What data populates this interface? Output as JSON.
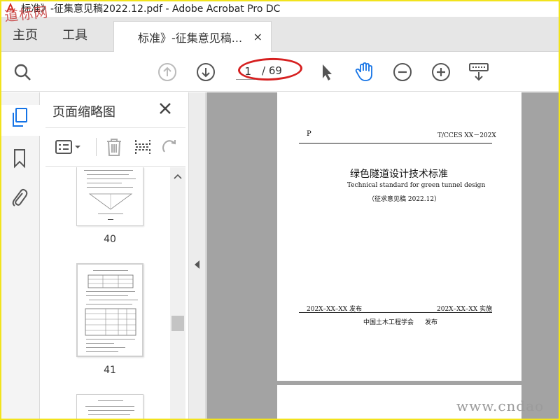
{
  "window": {
    "title": "标准》-征集意见稿2022.12.pdf - Adobe Acrobat Pro DC"
  },
  "tabs": {
    "home": "主页",
    "tools": "工具",
    "document": "标准》-征集意见稿...",
    "close": "×"
  },
  "toolbar": {
    "page_current": "1",
    "page_total": "/ 69",
    "icons": [
      "search-icon",
      "page-up-icon",
      "page-down-icon",
      "select-arrow-icon",
      "hand-tool-icon",
      "zoom-out-icon",
      "zoom-in-icon",
      "keyboard-icon"
    ]
  },
  "sidebar": {
    "title": "页面缩略图",
    "icons": [
      "thumbnails-icon",
      "bookmark-icon",
      "attachment-icon"
    ]
  },
  "thumbnails": [
    {
      "number": "40"
    },
    {
      "number": "41"
    }
  ],
  "document_page": {
    "left_code": "P",
    "right_code": "T/CCES XX－202X",
    "title_cn": "绿色隧道设计技术标准",
    "title_en": "Technical standard for green tunnel design",
    "draft": "（征求意见稿 2022.12）",
    "release": "202X–XX–XX  发布",
    "implement": "202X–XX–XX  实施",
    "publisher": "中国土木工程学会",
    "publish": "发布"
  },
  "watermarks": {
    "left": "道标网",
    "right": "www.cndao"
  },
  "colors": {
    "accent_blue": "#1473e6",
    "annotation_red": "#d62020",
    "frame_yellow": "#f2e31c"
  }
}
